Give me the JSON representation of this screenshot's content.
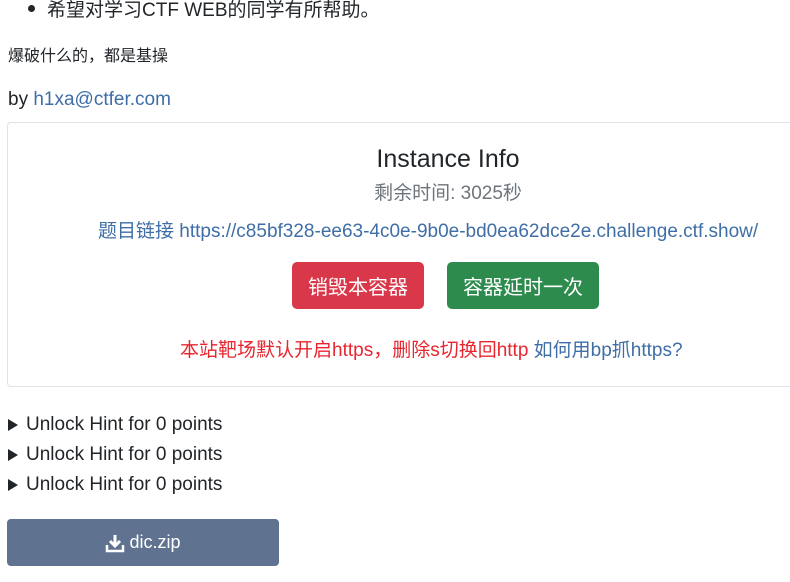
{
  "intro": {
    "bullet_text": "希望对学习CTF WEB的同学有所帮助。",
    "description": "爆破什么的，都是基操",
    "author_prefix": "by ",
    "author_email": "h1xa@ctfer.com"
  },
  "instance": {
    "title": "Instance Info",
    "time_label": "剩余时间: 3025秒",
    "link_label": "题目链接 ",
    "link_url": "https://c85bf328-ee63-4c0e-9b0e-bd0ea62dce2e.challenge.ctf.show/",
    "destroy_button": "销毁本容器",
    "extend_button": "容器延时一次",
    "https_notice": "本站靶场默认开启https，删除s切换回http",
    "https_help_link": "如何用bp抓https?"
  },
  "hints": [
    {
      "label": "Unlock Hint for 0 points"
    },
    {
      "label": "Unlock Hint for 0 points"
    },
    {
      "label": "Unlock Hint for 0 points"
    }
  ],
  "download": {
    "label": "dic.zip",
    "icon": "download-icon"
  },
  "colors": {
    "link": "#3f6ea7",
    "danger": "#d9384a",
    "success": "#2e8b4e",
    "warning_text": "#e8262f",
    "download_button": "#5f7290"
  }
}
